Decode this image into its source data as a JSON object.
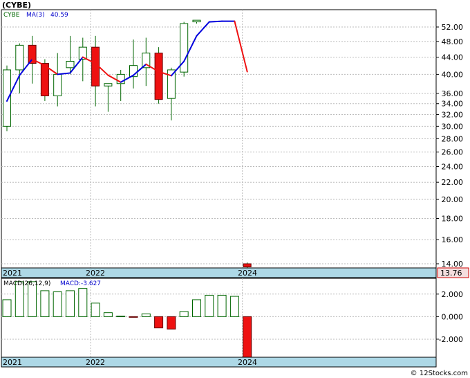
{
  "header": {
    "ticker_label": "(CYBE)"
  },
  "legend": {
    "symbol": "CYBE",
    "ma_label": "MA(3)",
    "ma_value": "40.59"
  },
  "macd_legend": {
    "label": "MACD(26,12,9)",
    "value_label": "MACD:-3.627"
  },
  "last_price_badge": "13.76",
  "watermark": "© 12Stocks.com",
  "x_tick_labels": [
    "2021",
    "2022",
    "2024"
  ],
  "colors": {
    "up": "#ffffff",
    "down": "#ee1111",
    "candle_outline": "#006600",
    "ma_up": "#0000dd",
    "ma_down": "#ee1111",
    "axis_band": "#add8e6",
    "grid": "#bbbbbb",
    "macd_pos": "#ffffff",
    "macd_neg": "#ee1111"
  },
  "chart_data": [
    {
      "type": "candlestick",
      "title": "(CYBE)",
      "y_scale": "log",
      "ylim": [
        14,
        56
      ],
      "y_ticks": [
        "52.00",
        "48.00",
        "44.00",
        "40.00",
        "36.00",
        "34.00",
        "32.00",
        "30.00",
        "28.00",
        "26.00",
        "24.00",
        "22.00",
        "20.00",
        "18.00",
        "16.00",
        "14.00"
      ],
      "x_ticks": [
        {
          "label": "2021",
          "index": 0
        },
        {
          "label": "2022",
          "index": 7
        },
        {
          "label": "2024",
          "index": 19
        }
      ],
      "candles": [
        {
          "o": 30.0,
          "h": 42.0,
          "l": 29.2,
          "c": 41.0
        },
        {
          "o": 41.0,
          "h": 47.5,
          "l": 36.0,
          "c": 47.0
        },
        {
          "o": 47.0,
          "h": 49.5,
          "l": 38.0,
          "c": 42.5
        },
        {
          "o": 42.5,
          "h": 43.5,
          "l": 34.5,
          "c": 35.5
        },
        {
          "o": 35.5,
          "h": 45.0,
          "l": 33.5,
          "c": 40.0
        },
        {
          "o": 41.5,
          "h": 49.5,
          "l": 40.0,
          "c": 43.0
        },
        {
          "o": 43.5,
          "h": 49.0,
          "l": 38.5,
          "c": 46.5
        },
        {
          "o": 46.5,
          "h": 49.5,
          "l": 33.5,
          "c": 37.5
        },
        {
          "o": 37.5,
          "h": 38.0,
          "l": 32.5,
          "c": 38.0
        },
        {
          "o": 38.0,
          "h": 41.0,
          "l": 34.5,
          "c": 40.0
        },
        {
          "o": 39.5,
          "h": 48.5,
          "l": 37.0,
          "c": 42.0
        },
        {
          "o": 41.5,
          "h": 49.0,
          "l": 37.5,
          "c": 45.0
        },
        {
          "o": 45.0,
          "h": 46.5,
          "l": 34.0,
          "c": 34.8
        },
        {
          "o": 35.0,
          "h": 41.5,
          "l": 31.0,
          "c": 41.0
        },
        {
          "o": 40.5,
          "h": 53.5,
          "l": 39.5,
          "c": 53.0
        },
        {
          "o": 53.5,
          "h": 54.0,
          "l": 53.0,
          "c": 54.0
        },
        null,
        null,
        null,
        {
          "o": 14.0,
          "h": 14.1,
          "l": 13.5,
          "c": 13.76
        }
      ],
      "ma3": [
        34.5,
        39.8,
        43.5,
        42.0,
        40.0,
        40.3,
        44.0,
        42.5,
        39.8,
        38.3,
        39.8,
        42.3,
        40.6,
        39.7,
        43.0,
        49.5,
        53.5,
        53.7,
        53.7,
        40.59
      ],
      "last_price": 13.76
    },
    {
      "type": "bar",
      "title": "MACD(26,12,9)",
      "ylim": [
        -3.6,
        3.4
      ],
      "y_ticks": [
        "2.000",
        "0.000",
        "-2.000"
      ],
      "x_ticks": [
        {
          "label": "2021",
          "index": 0
        },
        {
          "label": "2022",
          "index": 7
        },
        {
          "label": "2024",
          "index": 19
        }
      ],
      "values": [
        1.5,
        3.1,
        3.1,
        2.3,
        2.2,
        2.3,
        2.5,
        1.2,
        0.35,
        0.05,
        -0.05,
        0.25,
        -1.0,
        -1.1,
        0.45,
        1.5,
        1.9,
        1.9,
        1.8,
        -3.627
      ]
    }
  ]
}
